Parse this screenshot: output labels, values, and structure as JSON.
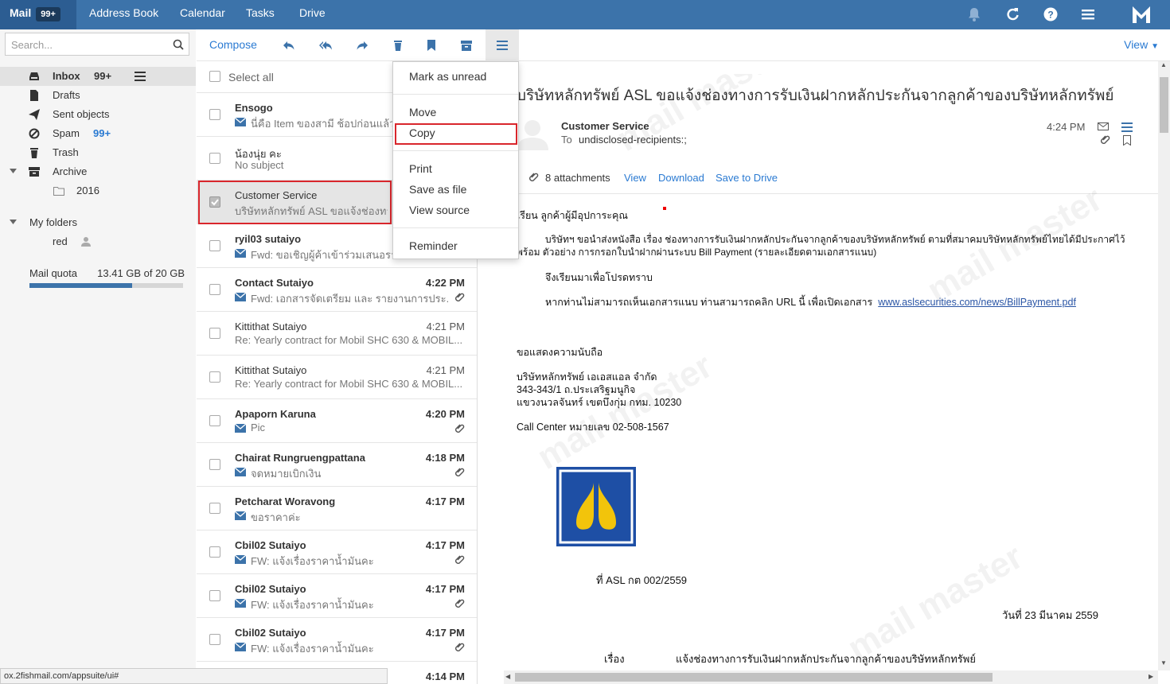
{
  "topbar": {
    "tabs": [
      {
        "label": "Mail",
        "badge": "99+"
      },
      {
        "label": "Address Book"
      },
      {
        "label": "Calendar"
      },
      {
        "label": "Tasks"
      },
      {
        "label": "Drive"
      }
    ]
  },
  "sidebar": {
    "search_placeholder": "Search...",
    "inbox": {
      "label": "Inbox",
      "count": "99+"
    },
    "drafts": "Drafts",
    "sent": "Sent objects",
    "spam": {
      "label": "Spam",
      "count": "99+"
    },
    "trash": "Trash",
    "archive": "Archive",
    "archive_sub": "2016",
    "my_folders": "My folders",
    "red": "red",
    "quota_label": "Mail quota",
    "quota_value": "13.41 GB of 20 GB",
    "quota_fraction": 0.67
  },
  "toolbar": {
    "compose": "Compose",
    "view": "View",
    "select_all": "Select all"
  },
  "menu": {
    "mark_unread": "Mark as unread",
    "move": "Move",
    "copy": "Copy",
    "print": "Print",
    "save_file": "Save as file",
    "view_source": "View source",
    "reminder": "Reminder"
  },
  "messages": [
    {
      "from": "Ensogo",
      "time": "",
      "subject": "นี่คือ Item ของสามี ช้อปก่อนแล้ว",
      "bold": true
    },
    {
      "from": "น้องนุ่ย คะ",
      "time": "",
      "subject": "No subject",
      "bold": false
    },
    {
      "from": "Customer Service",
      "time": "",
      "subject": "บริษัทหลักทรัพย์ ASL ขอแจ้งช่องทา",
      "bold": false
    },
    {
      "from": "ryil03 sutaiyo",
      "time": "",
      "subject": "Fwd: ขอเชิญผู้ค้าเข้าร่วมเสนอราค",
      "bold": true
    },
    {
      "from": "Contact Sutaiyo",
      "time": "4:22 PM",
      "subject": "Fwd: เอกสารจัดเตรียม และ รายงานการประ...",
      "bold": true
    },
    {
      "from": "Kittithat Sutaiyo",
      "time": "4:21 PM",
      "subject": "Re: Yearly contract for Mobil SHC 630 & MOBIL...",
      "bold": false
    },
    {
      "from": "Kittithat Sutaiyo",
      "time": "4:21 PM",
      "subject": "Re: Yearly contract for Mobil SHC 630 & MOBIL...",
      "bold": false
    },
    {
      "from": "Apaporn Karuna",
      "time": "4:20 PM",
      "subject": "Pic",
      "bold": true
    },
    {
      "from": "Chairat Rungruengpattana",
      "time": "4:18 PM",
      "subject": "จดหมายเบิกเงิน",
      "bold": true
    },
    {
      "from": "Petcharat Woravong",
      "time": "4:17 PM",
      "subject": "ขอราคาค่ะ",
      "bold": true
    },
    {
      "from": "Cbil02 Sutaiyo",
      "time": "4:17 PM",
      "subject": "FW: แจ้งเรื่องราคาน้ำมันคะ",
      "bold": true
    },
    {
      "from": "Cbil02 Sutaiyo",
      "time": "4:17 PM",
      "subject": "FW: แจ้งเรื่องราคาน้ำมันคะ",
      "bold": true
    },
    {
      "from": "Cbil02 Sutaiyo",
      "time": "4:17 PM",
      "subject": "FW: แจ้งเรื่องราคาน้ำมันคะ",
      "bold": true
    },
    {
      "from": "",
      "time": "4:14 PM",
      "subject": "",
      "bold": true
    }
  ],
  "reader": {
    "subject": "บริษัทหลักทรัพย์ ASL ขอแจ้งช่องทางการรับเงินฝากหลักประกันจากลูกค้าของบริษัทหลักทรัพย์",
    "sender": "Customer Service",
    "to_label": "To",
    "to": "undisclosed-recipients:;",
    "time": "4:24 PM",
    "attachments": "8 attachments",
    "att_view": "View",
    "att_download": "Download",
    "att_drive": "Save to Drive",
    "greeting": "เรียน  ลูกค้าผู้มีอุปการะคุณ",
    "para1": "บริษัทฯ ขอนำส่งหนังสือ เรื่อง ช่องทางการรับเงินฝากหลักประกันจากลูกค้าของบริษัทหลักทรัพย์ ตามที่สมาคมบริษัทหลักทรัพย์ไทยได้มีประกาศไว้",
    "para1b": "พร้อม ตัวอย่าง การกรอกใบนำฝากผ่านระบบ Bill Payment (รายละเอียดตามเอกสารแนบ)",
    "para2": "จึงเรียนมาเพื่อโปรดทราบ",
    "para3": "หากท่านไม่สามารถเห็นเอกสารแนบ ท่านสามารถคลิก URL นี้ เพื่อเปิดเอกสาร",
    "link": "www.aslsecurities.com/news/BillPayment.pdf",
    "closing": "ขอแสดงความนับถือ",
    "company": "บริษัทหลักทรัพย์ เอเอสแอล จำกัด",
    "addr1": "343-343/1 ถ.ประเสริฐมนูกิจ",
    "addr2": "แขวงนวลจันทร์ เขตบึงกุ่ม กทม. 10230",
    "callcenter": "Call Center หมายเลข 02-508-1567",
    "ref": "ที่  ASL กต 002/2559",
    "date": "วันที่  23  มีนาคม  2559",
    "topic_label": "เรื่อง",
    "topic": "แจ้งช่องทางการรับเงินฝากหลักประกันจากลูกค้าของบริษัทหลักทรัพย์"
  },
  "status_url": "ox.2fishmail.com/appsuite/ui#",
  "colors": {
    "topbar": "#3c73aa",
    "accent": "#2a7ad2",
    "highlight_box": "#d9262c",
    "logo_blue": "#1e4fa5",
    "logo_yellow": "#f2c40b"
  }
}
